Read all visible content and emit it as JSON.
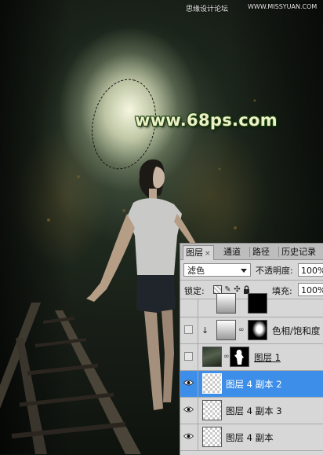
{
  "watermarks": {
    "top_left": "思缘设计论坛",
    "top_right": "WWW.MISSYUAN.COM"
  },
  "canvas": {
    "site_text": "www.68ps.com"
  },
  "panel": {
    "tabs": [
      {
        "label": "图层",
        "close": "×"
      },
      {
        "label": "通道"
      },
      {
        "label": "路径"
      },
      {
        "label": "历史记录"
      }
    ],
    "blend_mode": "滤色",
    "opacity_label": "不透明度:",
    "opacity_value": "100%",
    "lock_label": "锁定:",
    "fill_label": "填充:",
    "fill_value": "100%",
    "layers": [
      {
        "name": "",
        "visible": false,
        "selected": false,
        "partial": true
      },
      {
        "name": "色相/饱和度",
        "visible": false,
        "selected": false
      },
      {
        "name": "图层 1",
        "visible": false,
        "selected": false
      },
      {
        "name": "图层 4 副本 2",
        "visible": true,
        "selected": true
      },
      {
        "name": "图层 4 副本 3",
        "visible": true,
        "selected": false
      },
      {
        "name": "图层 4 副本",
        "visible": true,
        "selected": false
      }
    ]
  },
  "colors": {
    "selected_layer": "#3d8ee8",
    "site_text": "#eef0c6"
  }
}
